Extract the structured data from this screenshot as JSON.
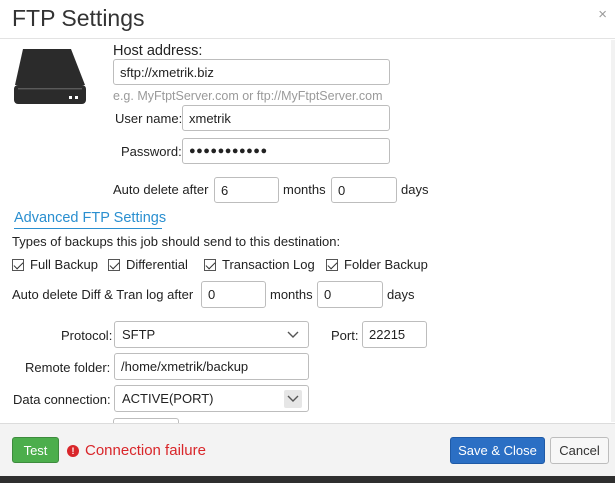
{
  "dialog": {
    "title": "FTP Settings",
    "close_label": "×"
  },
  "host": {
    "label": "Host address:",
    "value": "sftp://xmetrik.biz",
    "hint": "e.g. MyFtptServer.com or ftp://MyFtptServer.com"
  },
  "user": {
    "label": "User name:",
    "value": "xmetrik"
  },
  "password": {
    "label": "Password:",
    "value": "●●●●●●●●●●●"
  },
  "auto_delete": {
    "label": "Auto delete after",
    "months_value": "6",
    "months_label": "months",
    "days_value": "0",
    "days_label": "days"
  },
  "advanced": {
    "link": "Advanced FTP Settings",
    "types_label": "Types of backups this job should send to this destination:",
    "checkboxes": [
      {
        "label": "Full Backup",
        "checked": true
      },
      {
        "label": "Differential",
        "checked": true
      },
      {
        "label": "Transaction Log",
        "checked": true
      },
      {
        "label": "Folder Backup",
        "checked": true
      }
    ],
    "diff_tran_label": "Auto delete Diff & Tran log after",
    "diff_months_value": "0",
    "diff_months_label": "months",
    "diff_days_value": "0",
    "diff_days_label": "days"
  },
  "protocol": {
    "label": "Protocol:",
    "selected": "SFTP",
    "port_label": "Port:",
    "port_value": "22215"
  },
  "remote_folder": {
    "label": "Remote folder:",
    "value": "/home/xmetrik/backup"
  },
  "data_connection": {
    "label": "Data connection:",
    "selected": "ACTIVE(PORT)"
  },
  "footer": {
    "test_label": "Test",
    "error_icon": "!",
    "error_text": "Connection failure",
    "save_label": "Save & Close",
    "cancel_label": "Cancel"
  },
  "colors": {
    "accent_link": "#2a8fd0",
    "test_green": "#4cae4c",
    "save_blue": "#2b6fc4",
    "error_red": "#d9262a"
  },
  "icons": [
    "hard-drive-icon",
    "close-icon",
    "chevron-down-icon",
    "error-icon",
    "checkbox-checked-icon"
  ]
}
